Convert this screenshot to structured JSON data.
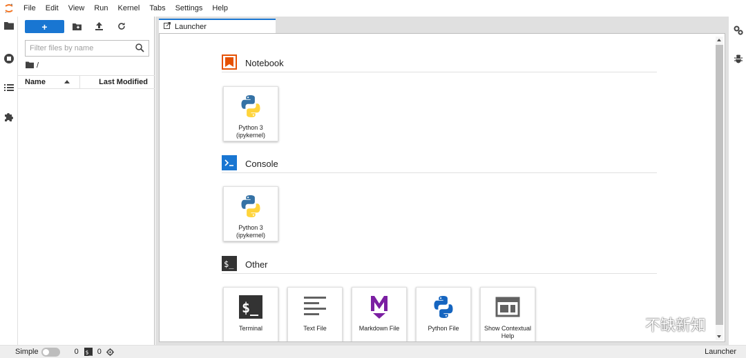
{
  "menubar": {
    "items": [
      "File",
      "Edit",
      "View",
      "Run",
      "Kernel",
      "Tabs",
      "Settings",
      "Help"
    ]
  },
  "file_browser": {
    "new_button_label": "+",
    "filter_placeholder": "Filter files by name",
    "breadcrumb": "/",
    "columns": {
      "name": "Name",
      "modified": "Last Modified"
    }
  },
  "tab": {
    "label": "Launcher"
  },
  "launcher": {
    "sections": [
      {
        "title": "Notebook",
        "cards": [
          {
            "label": "Python 3 (ipykernel)"
          }
        ]
      },
      {
        "title": "Console",
        "cards": [
          {
            "label": "Python 3 (ipykernel)"
          }
        ]
      },
      {
        "title": "Other",
        "cards": [
          {
            "label": "Terminal"
          },
          {
            "label": "Text File"
          },
          {
            "label": "Markdown File"
          },
          {
            "label": "Python File"
          },
          {
            "label": "Show Contextual Help"
          }
        ]
      }
    ]
  },
  "statusbar": {
    "mode_label": "Simple",
    "terminals_count": "0",
    "kernels_count": "0",
    "right_label": "Launcher"
  },
  "watermark": "不缺新知",
  "colors": {
    "accent": "#1976d2",
    "notebook_orange": "#e65100",
    "console_blue": "#1976d2",
    "markdown_purple": "#7b1fa2",
    "python_blue": "#3572a5",
    "python_yellow": "#ffd43b"
  }
}
